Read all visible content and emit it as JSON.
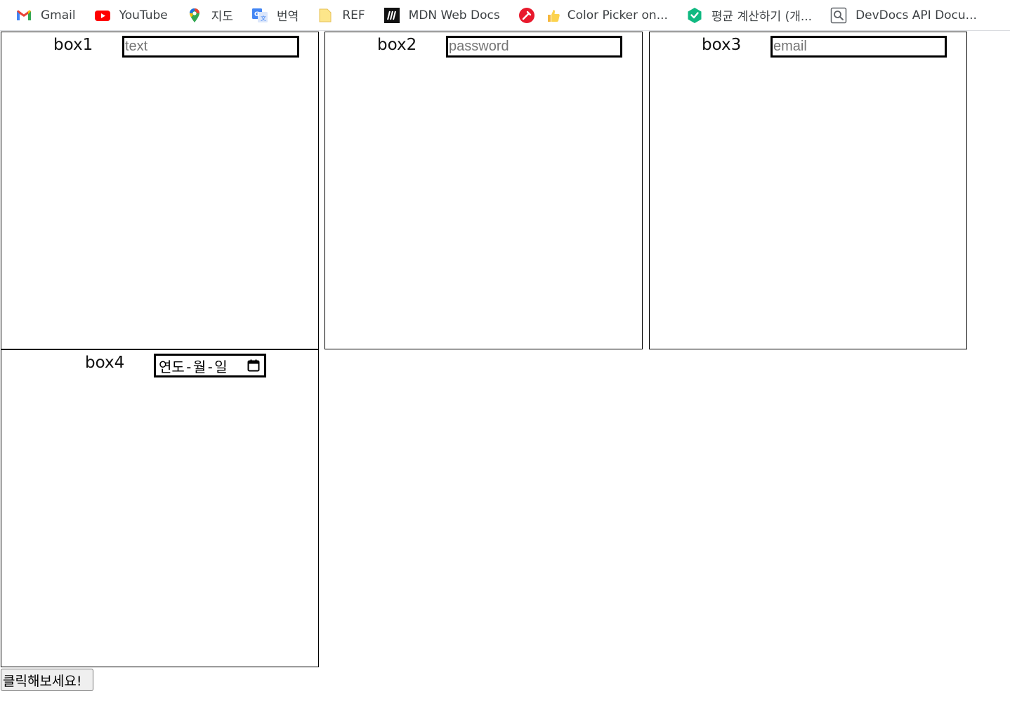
{
  "bookmarks": [
    {
      "label": "Gmail",
      "icon": "gmail-icon"
    },
    {
      "label": "YouTube",
      "icon": "youtube-icon"
    },
    {
      "label": "지도",
      "icon": "maps-pin-icon"
    },
    {
      "label": "번역",
      "icon": "translate-icon"
    },
    {
      "label": "REF",
      "icon": "folder-icon"
    },
    {
      "label": "MDN Web Docs",
      "icon": "mdn-icon"
    },
    {
      "label": "",
      "icon": "color-picker-icon"
    },
    {
      "label": "Color Picker on...",
      "icon": "thumbs-up-icon"
    },
    {
      "label": "평균 계산하기 (개...",
      "icon": "green-hexagon-icon"
    },
    {
      "label": "DevDocs API Docu...",
      "icon": "devdocs-icon"
    }
  ],
  "boxes": [
    {
      "label": "box1",
      "input_type": "text",
      "placeholder": "text"
    },
    {
      "label": "box2",
      "input_type": "password",
      "placeholder": "password"
    },
    {
      "label": "box3",
      "input_type": "email",
      "placeholder": "email"
    },
    {
      "label": "box4",
      "input_type": "date",
      "date_placeholder": "연도-월-일"
    }
  ],
  "button": {
    "label": "클릭해보세요!"
  },
  "colors": {
    "border": "#000000",
    "placeholder": "#757575",
    "button_bg": "#efefef"
  }
}
